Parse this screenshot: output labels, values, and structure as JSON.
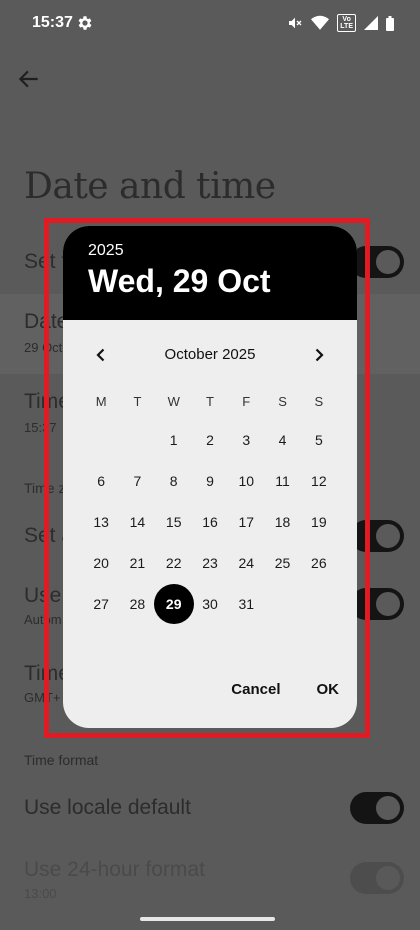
{
  "status_bar": {
    "time": "15:37",
    "volte_label": "Vo\nLTE"
  },
  "page": {
    "title": "Date and time",
    "rows": [
      {
        "title": "Set time automatically",
        "visible_title": "Set t",
        "sub": ""
      },
      {
        "title": "Date",
        "visible_title": "Date",
        "sub": "29 Oct"
      },
      {
        "title": "Time",
        "visible_title": "Time",
        "sub": "15:37"
      },
      {
        "section": "Time z"
      },
      {
        "title": "Set a",
        "sub": ""
      },
      {
        "title": "Use",
        "sub": "Autom"
      },
      {
        "title": "Time",
        "sub": "GMT+"
      }
    ],
    "time_format_label": "Time format",
    "use_locale_default": "Use locale default",
    "use_24_hour": "Use 24-hour format",
    "use_24_hour_sub": "13:00"
  },
  "dialog": {
    "year": "2025",
    "date": "Wed, 29 Oct",
    "month": "October 2025",
    "weekdays": [
      "M",
      "T",
      "W",
      "T",
      "F",
      "S",
      "S"
    ],
    "days": [
      "",
      "",
      "1",
      "2",
      "3",
      "4",
      "5",
      "6",
      "7",
      "8",
      "9",
      "10",
      "11",
      "12",
      "13",
      "14",
      "15",
      "16",
      "17",
      "18",
      "19",
      "20",
      "21",
      "22",
      "23",
      "24",
      "25",
      "26",
      "27",
      "28",
      "29",
      "30",
      "31"
    ],
    "selected_day": "29",
    "cancel_label": "Cancel",
    "ok_label": "OK"
  }
}
